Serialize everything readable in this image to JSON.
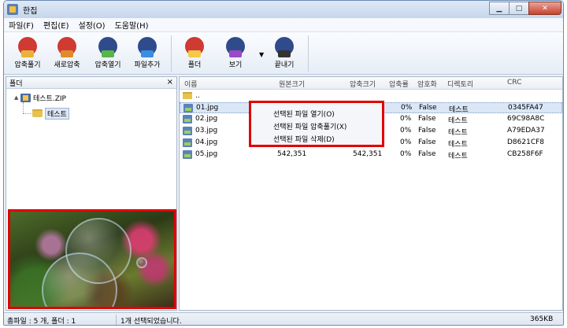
{
  "window": {
    "title": "한집"
  },
  "menu": [
    "파일(F)",
    "편집(E)",
    "설정(O)",
    "도움말(H)"
  ],
  "toolbar": {
    "buttons": [
      {
        "label": "압축풀기",
        "icon": "extract-icon"
      },
      {
        "label": "새로압축",
        "icon": "new-archive-icon"
      },
      {
        "label": "압축열기",
        "icon": "open-archive-icon"
      },
      {
        "label": "파일추가",
        "icon": "add-file-icon"
      },
      {
        "label": "폴더",
        "icon": "folder-view-icon"
      },
      {
        "label": "보기",
        "icon": "view-icon"
      },
      {
        "label": "끝내기",
        "icon": "exit-icon"
      }
    ]
  },
  "folder_pane": {
    "header": "폴더",
    "close": "×",
    "tree": {
      "root": "테스트.ZIP",
      "child": "테스트"
    }
  },
  "file_list": {
    "columns": [
      "이름",
      "원본크기",
      "압축크기",
      "압축률",
      "암호화",
      "디렉토리",
      "CRC"
    ],
    "parent": "..",
    "rows": [
      {
        "name": "01.jpg",
        "original": "",
        "compressed": "",
        "ratio": "0%",
        "encrypted": "False",
        "dir": "테스트",
        "crc": "0345FA47"
      },
      {
        "name": "02.jpg",
        "original": "",
        "compressed": "",
        "ratio": "0%",
        "encrypted": "False",
        "dir": "테스트",
        "crc": "69C98A8C"
      },
      {
        "name": "03.jpg",
        "original": "",
        "compressed": "",
        "ratio": "0%",
        "encrypted": "False",
        "dir": "테스트",
        "crc": "A79EDA37"
      },
      {
        "name": "04.jpg",
        "original": "",
        "compressed": "",
        "ratio": "0%",
        "encrypted": "False",
        "dir": "테스트",
        "crc": "D8621CF8"
      },
      {
        "name": "05.jpg",
        "original": "542,351",
        "compressed": "542,351",
        "ratio": "0%",
        "encrypted": "False",
        "dir": "테스트",
        "crc": "CB258F6F"
      }
    ]
  },
  "context_menu": {
    "items": [
      "선택된 파일 열기(O)",
      "선택된 파일 압축풀기(X)",
      "선택된 파일 삭제(D)"
    ]
  },
  "status": {
    "counts": "총파일 : 5 개, 폴더 : 1",
    "selection": "1개 선택되었습니다.",
    "size": "365KB"
  }
}
